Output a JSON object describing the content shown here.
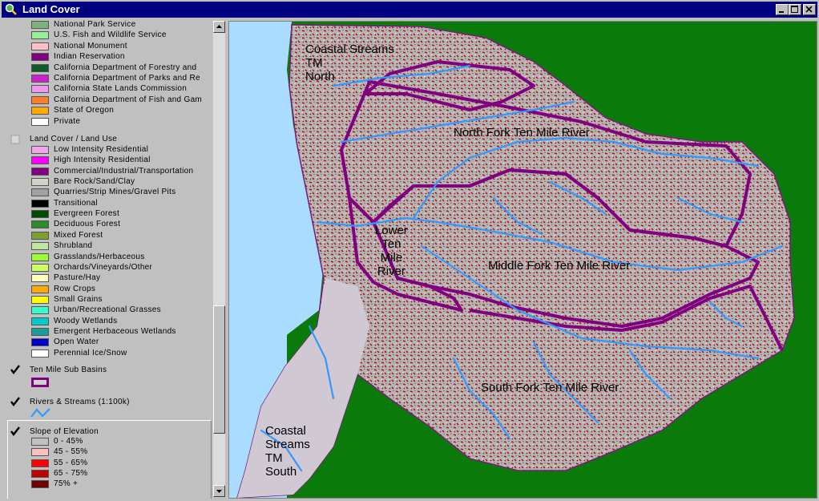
{
  "window": {
    "title": "Land Cover",
    "app_icon": "magnifier-globe-icon",
    "buttons": [
      "minimize",
      "maximize",
      "close"
    ]
  },
  "toc": {
    "ownership_items": [
      {
        "label": "National Park Service",
        "color": "#7fb27f"
      },
      {
        "label": "U.S. Fish and Wildlife Service",
        "color": "#99ee99"
      },
      {
        "label": "National Monument",
        "color": "#ffc0c8"
      },
      {
        "label": "Indian Reservation",
        "color": "#800080"
      },
      {
        "label": "California Department of Forestry and",
        "color": "#0d5a2a"
      },
      {
        "label": "California Department of Parks and Re",
        "color": "#cc22cc"
      },
      {
        "label": "California State Lands Commission",
        "color": "#ee99ee"
      },
      {
        "label": "California Department of Fish and Gam",
        "color": "#ff7f27"
      },
      {
        "label": "State of Oregon",
        "color": "#ffaa00"
      },
      {
        "label": "Private",
        "color": "#ffffff"
      }
    ],
    "land_cover": {
      "title": "Land Cover / Land Use",
      "checked": false,
      "items": [
        {
          "label": "Low Intensity Residential",
          "color": "#f2a6ea"
        },
        {
          "label": "High Intensity Residential",
          "color": "#ff00ff"
        },
        {
          "label": "Commercial/Industrial/Transportation",
          "color": "#7f0080"
        },
        {
          "label": "Bare Rock/Sand/Clay",
          "color": "#d2d2c8"
        },
        {
          "label": "Quarries/Strip Mines/Gravel Pits",
          "color": "#a0a0a0"
        },
        {
          "label": "Transitional",
          "color": "#000000"
        },
        {
          "label": "Evergreen Forest",
          "color": "#004d00"
        },
        {
          "label": "Deciduous Forest",
          "color": "#2d8a2d"
        },
        {
          "label": "Mixed Forest",
          "color": "#7aa032"
        },
        {
          "label": "Shrubland",
          "color": "#bfe6a0"
        },
        {
          "label": "Grasslands/Herbaceous",
          "color": "#99ff33"
        },
        {
          "label": "Orchards/Vineyards/Other",
          "color": "#ccff66"
        },
        {
          "label": "Pasture/Hay",
          "color": "#ffffbb"
        },
        {
          "label": "Row Crops",
          "color": "#ffaa00"
        },
        {
          "label": "Small Grains",
          "color": "#ffff00"
        },
        {
          "label": "Urban/Recreational Grasses",
          "color": "#33ffcc"
        },
        {
          "label": "Woody Wetlands",
          "color": "#00cccc"
        },
        {
          "label": "Emergent Herbaceous Wetlands",
          "color": "#1e9a9a"
        },
        {
          "label": "Open Water",
          "color": "#0000cc"
        },
        {
          "label": "Perennial Ice/Snow",
          "color": "#ffffff"
        }
      ]
    },
    "sub_basins": {
      "title": "Ten Mile Sub Basins",
      "checked": true,
      "color": "#800080"
    },
    "rivers": {
      "title": "Rivers & Streams (1:100k)",
      "checked": true,
      "color": "#3399ff"
    },
    "slope": {
      "title": "Slope of Elevation",
      "checked": true,
      "items": [
        {
          "label": "0 - 45%",
          "color": "#c0c0c0"
        },
        {
          "label": "45 - 55%",
          "color": "#ffc0c0"
        },
        {
          "label": "55 - 65%",
          "color": "#ff0000"
        },
        {
          "label": "65 - 75%",
          "color": "#c00000"
        },
        {
          "label": "75% +",
          "color": "#700000"
        }
      ]
    }
  },
  "map": {
    "labels": {
      "coastal_north": [
        "Coastal Streams",
        "TM",
        "North"
      ],
      "north_fork": "North Fork Ten Mile River",
      "lower": [
        "Lower",
        "Ten",
        "Mile",
        "River"
      ],
      "middle_fork": "Middle Fork Ten Mile River",
      "south_fork": "South Fork Ten Mile River",
      "coastal_south": [
        "Coastal",
        "Streams",
        "TM",
        "South"
      ]
    },
    "colors": {
      "ocean": "#aadcff",
      "land": "#0a7a0a",
      "terrain": "#b4b4b4",
      "boundary": "#800080",
      "streams": "#3399ff",
      "slope_high": "#b00000"
    }
  }
}
